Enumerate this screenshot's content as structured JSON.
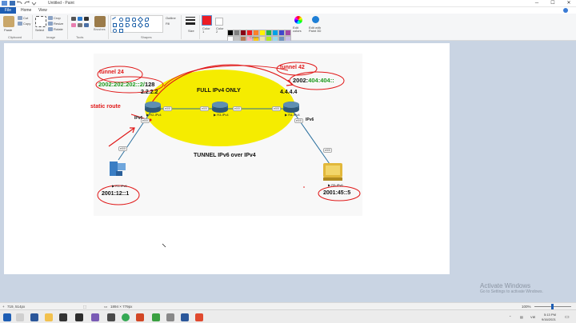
{
  "window": {
    "title": "Untitled - Paint",
    "minimize": "─",
    "maximize": "☐",
    "close": "✕"
  },
  "menu": {
    "file": "File",
    "home": "Home",
    "view": "View"
  },
  "ribbon": {
    "clipboard": {
      "paste": "Paste",
      "cut": "Cut",
      "copy": "Copy",
      "label": "Clipboard"
    },
    "image": {
      "select": "Select",
      "crop": "Crop",
      "resize": "Resize",
      "rotate": "Rotate",
      "label": "Image"
    },
    "tools": {
      "label": "Tools"
    },
    "brushes": {
      "label": "Brushes"
    },
    "shapes": {
      "outline": "Outline",
      "fill": "Fill",
      "label": "Shapes"
    },
    "size": {
      "label": "Size"
    },
    "color1": {
      "label": "Color\n1"
    },
    "color2": {
      "label": "Color\n2"
    },
    "colors": {
      "label": "Colors",
      "edit": "Edit\ncolors",
      "paint3d": "Edit with\nPaint 3D"
    },
    "palette_top": [
      "#000000",
      "#7f7f7f",
      "#880015",
      "#ed1c24",
      "#ff7f27",
      "#fff200",
      "#22b14c",
      "#00a2e8",
      "#3f48cc",
      "#a349a4"
    ],
    "palette_bottom": [
      "#ffffff",
      "#c3c3c3",
      "#b97a57",
      "#ffaec9",
      "#ffc90e",
      "#efe4b0",
      "#b5e61d",
      "#99d9ea",
      "#7092be",
      "#c8bfe7"
    ],
    "color1_value": "#ed1c24"
  },
  "diagram": {
    "tunnel_left": "tunnel 24",
    "tunnel_right": "tunnel 42",
    "addr_left_prefix": "2002:202:202::2/",
    "addr_left_suffix": "128",
    "addr_right_prefix": "2002:",
    "addr_right_suffix": "404:404::",
    "ipv4_left": "2.2.2.2",
    "ipv4_right": "4.4.4.4",
    "full_ipv4": "FULL IPv4 ONLY",
    "tunnel_title": "TUNNEL IPv6 over IPv4",
    "static_route": "static route",
    "ipv6_left": "IPv6",
    "ipv6_right": "IPv6",
    "host_left_addr": "2001:12::1",
    "host_right_addr": "2001:45::5",
    "r2": "▶ R2-IPv4",
    "r3": "▶ R3-IPv4",
    "r4": "▶ R4-IPv4",
    "r1": "▶ R1-IPv6",
    "r5": "▶ R5-IPv6",
    "port_label": "e0/0"
  },
  "watermark": {
    "title": "Activate Windows",
    "subtitle": "Go to Settings to activate Windows."
  },
  "status": {
    "cursor": "719, 514px",
    "canvas_size": "1894 × 779px",
    "zoom": "100%"
  },
  "taskbar": {
    "time": "5:13 PM",
    "date": "9/16/2021",
    "lang": "VIE"
  },
  "colors": {
    "accent": "#1e5eb4",
    "ellipse": "#f5ec00",
    "annotation": "#e01818"
  }
}
